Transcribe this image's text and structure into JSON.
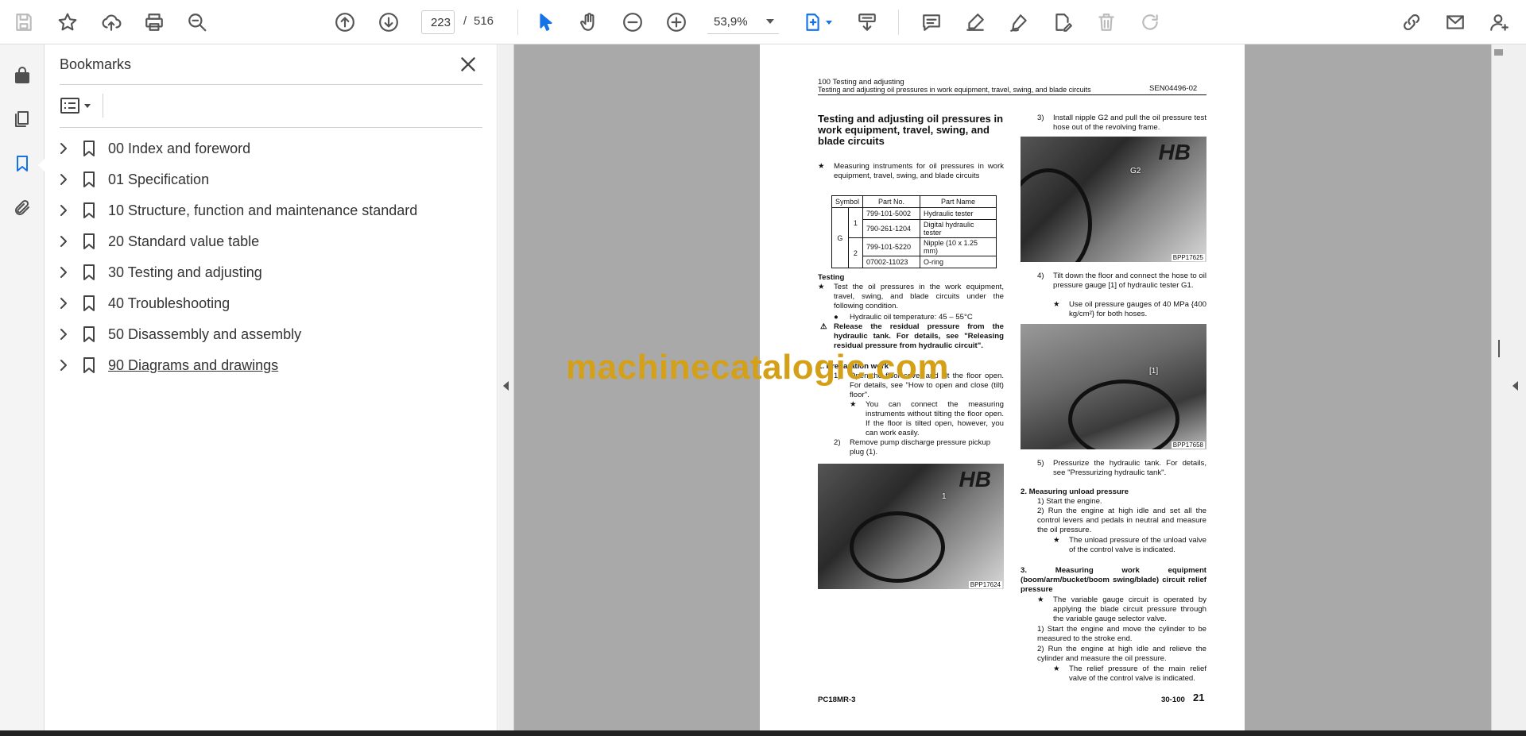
{
  "toolbar": {
    "page_current": "223",
    "page_separator": "/",
    "page_total": "516",
    "zoom": "53,9%"
  },
  "bookmarks": {
    "title": "Bookmarks",
    "items": [
      {
        "label": "00 Index and foreword"
      },
      {
        "label": "01 Specification"
      },
      {
        "label": "10 Structure, function and maintenance standard"
      },
      {
        "label": "20 Standard value table"
      },
      {
        "label": "30 Testing and adjusting"
      },
      {
        "label": "40 Troubleshooting"
      },
      {
        "label": "50 Disassembly and assembly"
      },
      {
        "label": "90 Diagrams and drawings"
      }
    ]
  },
  "doc": {
    "header_line1": "100 Testing and adjusting",
    "header_line2": "Testing and adjusting oil pressures in work equipment, travel, swing, and blade circuits",
    "header_code": "SEN04496-02",
    "title": "Testing and adjusting oil pressures in work equipment, travel, swing, and blade circuits",
    "intro_star": "★",
    "intro": "Measuring instruments for oil pressures in work equipment, travel, swing, and blade circuits",
    "table": {
      "headers": [
        "Symbol",
        "Part No.",
        "Part Name"
      ],
      "symbol": "G",
      "rows": [
        {
          "no": "1",
          "part": "799-101-5002",
          "name": "Hydraulic tester"
        },
        {
          "no": "",
          "part": "790-261-1204",
          "name": "Digital hydraulic tester"
        },
        {
          "no": "2",
          "part": "799-101-5220",
          "name": "Nipple (10 x 1.25 mm)"
        },
        {
          "no": "",
          "part": "07002-11023",
          "name": "O-ring"
        }
      ]
    },
    "testing_heading": "Testing",
    "testing_text": "Test the oil pressures in the work equipment, travel, swing, and blade circuits under the following condition.",
    "bullet_temp": "Hydraulic oil temperature: 45 – 55°C",
    "warning": "Release the residual pressure from the hydraulic tank.  For details, see \"Releasing residual pressure from hydraulic circuit\".",
    "step1_heading": "1.  Preparation work",
    "step1_1": "Open the floor cover and tilt the floor open.  For details, see \"How to open and close (tilt) floor\".",
    "step1_1_note": "You can connect the measuring instruments without tilting the floor open.  If the floor is tilted open, however, you can work easily.",
    "step1_2": "Remove pump discharge pressure pickup plug (1).",
    "photo1_label": "BPP17624",
    "photo1_callout": "1",
    "step3": "Install nipple G2 and pull the oil pressure test hose out of the revolving frame.",
    "photo2_label": "BPP17625",
    "photo2_callout": "G2",
    "step4": "Tilt down the floor and connect the hose to oil pressure gauge [1] of hydraulic tester G1.",
    "step4_note": "Use oil pressure gauges of 40 MPa {400 kg/cm²} for both hoses.",
    "photo3_label": "BPP17658",
    "photo3_callout": "[1]",
    "step5": "Pressurize the hydraulic tank.  For details, see \"Pressurizing hydraulic tank\".",
    "sec2": "2.  Measuring unload pressure",
    "sec2_1": "1)  Start the engine.",
    "sec2_2": "2)  Run the engine at high idle and set all the control levers and pedals in neutral and measure the oil pressure.",
    "sec2_note": "The unload pressure of the unload valve of the control valve is indicated.",
    "sec3": "3.  Measuring work equipment (boom/arm/bucket/boom swing/blade) circuit relief pressure",
    "sec3_note": "The variable gauge circuit is operated by applying the blade circuit pressure through the variable gauge selector valve.",
    "sec3_1": "1)  Start the engine and move the cylinder to be measured to the stroke end.",
    "sec3_2": "2)  Run the engine at high idle and relieve the cylinder and measure the oil pressure.",
    "sec3_note2": "The relief pressure of the main relief valve of the control valve is indicated.",
    "footer_left": "PC18MR-3",
    "footer_right": "30-100",
    "footer_page": "21"
  },
  "watermark": "machinecatalogic.com"
}
